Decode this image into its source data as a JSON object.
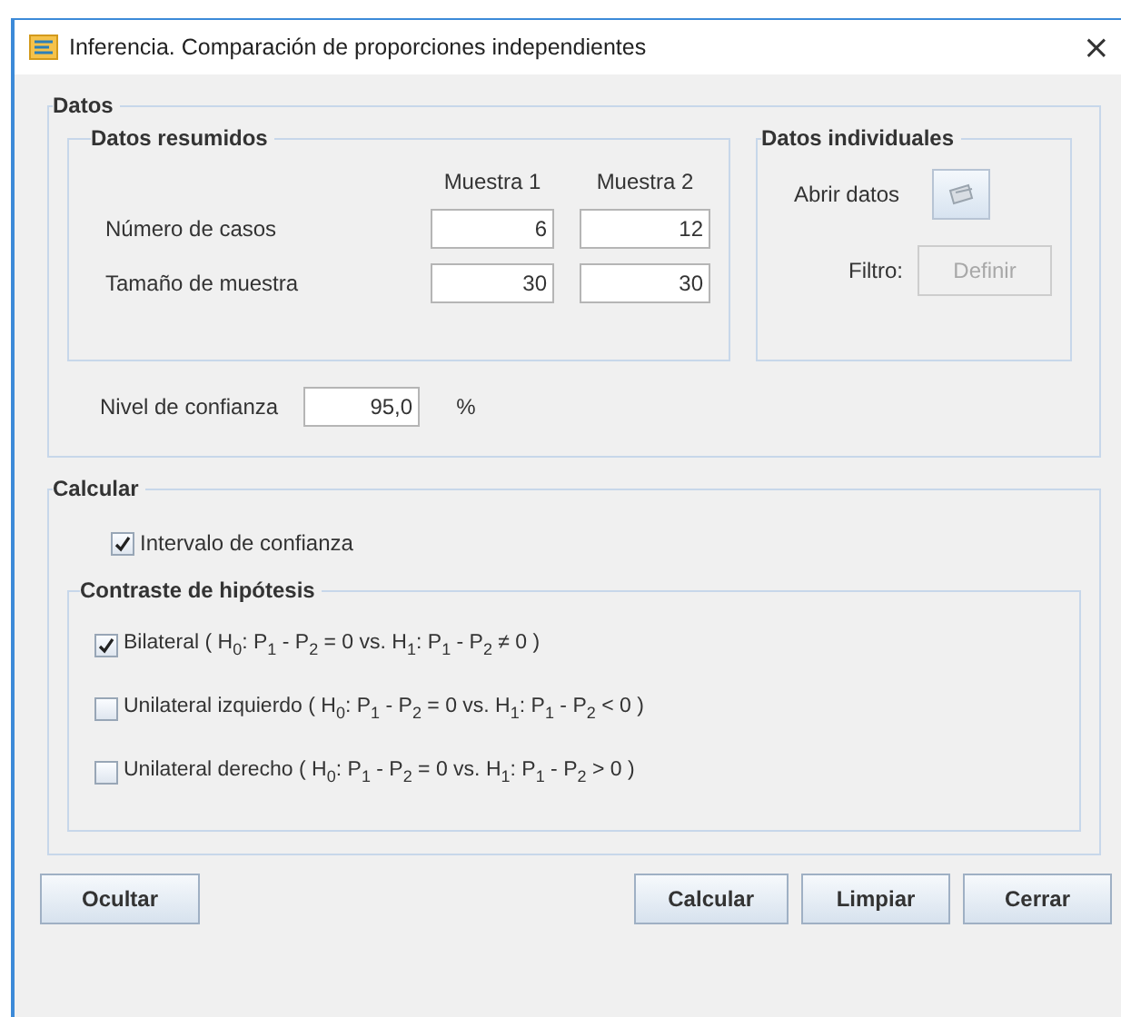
{
  "window": {
    "title": "Inferencia. Comparación de proporciones independientes",
    "close": "×"
  },
  "datos": {
    "legend": "Datos",
    "resumidos": {
      "legend": "Datos resumidos",
      "columns": [
        "Muestra 1",
        "Muestra 2"
      ],
      "rows": [
        {
          "label": "Número de casos",
          "values": [
            "6",
            "12"
          ]
        },
        {
          "label": "Tamaño de muestra",
          "values": [
            "30",
            "30"
          ]
        }
      ]
    },
    "individuales": {
      "legend": "Datos individuales",
      "open_label": "Abrir datos",
      "filter_label": "Filtro:",
      "filter_button": {
        "label": "Definir",
        "disabled": true
      }
    },
    "confidence": {
      "label": "Nivel de confianza",
      "value": "95,0",
      "unit": "%"
    }
  },
  "calcular": {
    "legend": "Calcular",
    "interval": {
      "label": "Intervalo de confianza",
      "checked": true
    },
    "contraste": {
      "legend": "Contraste de hipótesis",
      "options": [
        {
          "label": "Bilateral ( H$_{0}$: P$_{1}$ - P$_{2}$ = 0 vs. H$_{1}$: P$_{1}$ - P$_{2}$ ≠ 0 )",
          "checked": true
        },
        {
          "label": "Unilateral izquierdo ( H$_{0}$: P$_{1}$ - P$_{2}$ = 0 vs. H$_{1}$: P$_{1}$ - P$_{2}$ < 0 )",
          "checked": false
        },
        {
          "label": "Unilateral derecho ( H$_{0}$: P$_{1}$ - P$_{2}$ = 0 vs. H$_{1}$: P$_{1}$ - P$_{2}$ > 0 )",
          "checked": false
        }
      ]
    }
  },
  "buttons_left": [
    "Ocultar"
  ],
  "buttons_right": [
    "Calcular",
    "Limpiar",
    "Cerrar"
  ]
}
